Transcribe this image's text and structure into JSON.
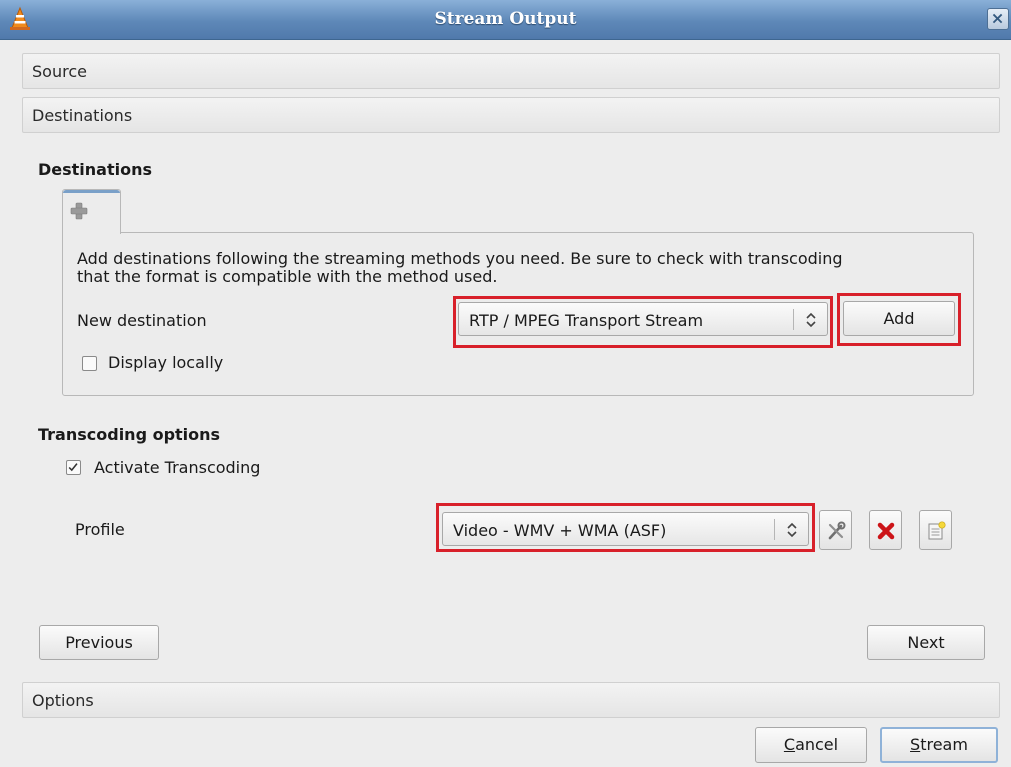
{
  "window": {
    "title": "Stream Output"
  },
  "sections": {
    "source": "Source",
    "destinations": "Destinations",
    "options": "Options"
  },
  "destinations": {
    "group_title": "Destinations",
    "tab_icon": "add-icon",
    "description_line1": "Add destinations following the streaming methods you need. Be sure to check with transcoding",
    "description_line2": "that the format is compatible with the method used.",
    "new_destination_label": "New destination",
    "new_destination_selected": "RTP / MPEG Transport Stream",
    "add_button": "Add",
    "display_locally_label": "Display locally",
    "display_locally_checked": false
  },
  "transcoding": {
    "group_title": "Transcoding options",
    "activate_label": "Activate Transcoding",
    "activate_checked": true,
    "profile_label": "Profile",
    "profile_selected": "Video - WMV + WMA (ASF)",
    "profile_icons": [
      "edit-profile-icon",
      "delete-profile-icon",
      "new-profile-icon"
    ]
  },
  "nav": {
    "previous": "Previous",
    "next": "Next"
  },
  "footer": {
    "cancel_first": "C",
    "cancel_rest": "ancel",
    "stream_first": "S",
    "stream_rest": "tream"
  },
  "colors": {
    "highlight": "#d8202a",
    "titlebar": "#5e88b8"
  }
}
